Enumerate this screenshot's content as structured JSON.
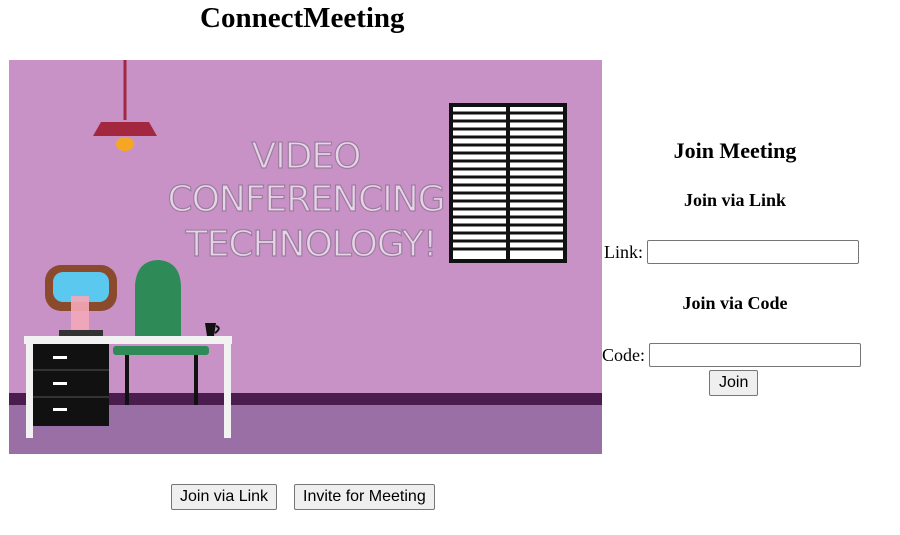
{
  "app": {
    "title": "ConnectMeeting"
  },
  "hero": {
    "headline_lines": [
      "VIDEO",
      "CONFERENCING",
      "TECHNOLOGY!"
    ],
    "colors": {
      "wall": "#c892c7",
      "floor": "#9a6fa6",
      "baseboard": "#4a1d4e",
      "chair": "#2e8b57",
      "lamp": "#a3283f"
    }
  },
  "join_panel": {
    "heading": "Join Meeting",
    "link_section": {
      "heading": "Join via Link",
      "label": "Link:",
      "value": ""
    },
    "code_section": {
      "heading": "Join via Code",
      "label": "Code:",
      "value": ""
    },
    "join_button": "Join"
  },
  "footer": {
    "join_via_link_button": "Join via Link",
    "invite_button": "Invite for Meeting"
  }
}
